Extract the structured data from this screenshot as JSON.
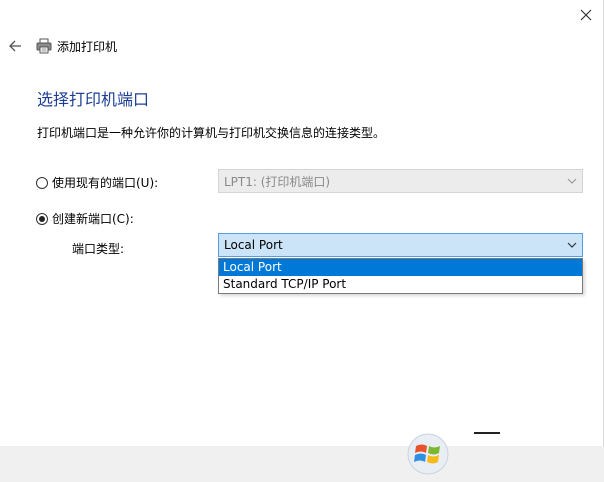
{
  "window": {
    "title": "添加打印机"
  },
  "heading": "选择打印机端口",
  "description": "打印机端口是一种允许你的计算机与打印机交换信息的连接类型。",
  "existing_port": {
    "label": "使用现有的端口(U):",
    "checked": false,
    "value": "LPT1: (打印机端口)"
  },
  "new_port": {
    "label": "创建新端口(C):",
    "checked": true,
    "type_label": "端口类型:",
    "value": "Local Port",
    "options": [
      "Local Port",
      "Standard TCP/IP Port"
    ],
    "highlighted_option": "Local Port"
  },
  "icons": {
    "back": "back-arrow-icon",
    "printer": "printer-icon",
    "close": "close-icon",
    "chevron": "chevron-down-icon"
  },
  "colors": {
    "heading": "#1c3f94",
    "selection": "#0078d7",
    "combo_active_bg": "#cce4f7",
    "combo_active_border": "#569de5"
  }
}
